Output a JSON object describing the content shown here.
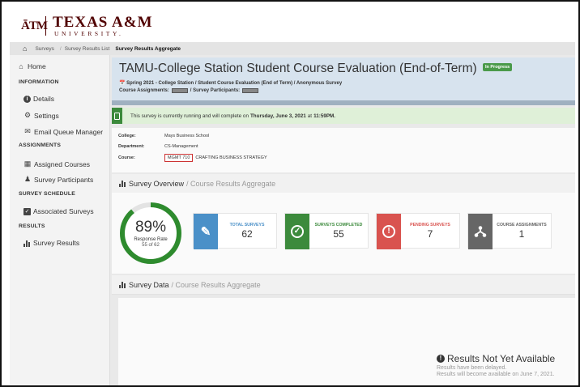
{
  "brand": {
    "logo_mark": "ATM",
    "name": "TEXAS A&M",
    "sub": "UNIVERSITY."
  },
  "breadcrumb": {
    "items": [
      "Surveys",
      "Survey Results List",
      "Survey Results Aggregate"
    ]
  },
  "sidebar": {
    "home": "Home",
    "info_head": "INFORMATION",
    "details": "Details",
    "settings": "Settings",
    "email_queue": "Email Queue Manager",
    "assign_head": "ASSIGNMENTS",
    "assigned_courses": "Assigned Courses",
    "survey_participants": "Survey Participants",
    "schedule_head": "SURVEY SCHEDULE",
    "associated_surveys": "Associated Surveys",
    "results_head": "RESULTS",
    "survey_results": "Survey Results"
  },
  "survey": {
    "title": "TAMU-College Station Student Course Evaluation (End-of-Term)",
    "status": "In Progress",
    "meta": "Spring 2021 - College Station / Student Course Evaluation (End of Term) / Anonymous Survey",
    "course_assignments_label": "Course Assignments:",
    "survey_participants_label": "/ Survey Participants:"
  },
  "alert": {
    "text_before": "This survey is currently running and will complete on",
    "date": "Thursday, June 3, 2021",
    "at": "at",
    "time": "11:59PM."
  },
  "info": {
    "college_label": "College:",
    "college_value": "Mays Business School",
    "department_label": "Department:",
    "department_value": "CS-Management",
    "course_label": "Course:",
    "course_code": "MGMT 710",
    "course_name": "CRAFTING BUSINESS STRATEGY"
  },
  "overview": {
    "title": "Survey Overview",
    "subtitle": "/ Course Results Aggregate",
    "response_rate_pct": "89%",
    "response_rate_fraction": 0.89,
    "response_rate_label": "Response Rate",
    "response_rate_detail": "55 of 62",
    "stats": [
      {
        "label": "TOTAL SURVEYS",
        "value": "62",
        "color": "#4a90c8",
        "label_color": "#4a90c8",
        "icon": "pencil-icon"
      },
      {
        "label": "SURVEYS COMPLETED",
        "value": "55",
        "color": "#3c8a3c",
        "label_color": "#3c8a3c",
        "icon": "check-icon"
      },
      {
        "label": "PENDING SURVEYS",
        "value": "7",
        "color": "#d9534f",
        "label_color": "#d9534f",
        "icon": "exclamation-icon"
      },
      {
        "label": "COURSE ASSIGNMENTS",
        "value": "1",
        "color": "#666666",
        "label_color": "#666666",
        "icon": "sitemap-icon"
      }
    ]
  },
  "survey_data": {
    "title": "Survey Data",
    "subtitle": "/ Course Results Aggregate",
    "nyr_title": "Results Not Yet Available",
    "nyr_line1": "Results have been delayed.",
    "nyr_line2": "Results will become available on June 7, 2021."
  },
  "colors": {
    "brand_maroon": "#500000",
    "gauge_green": "#2e8b2e",
    "header_blue": "#d7e3ee",
    "alert_green": "#dff0d8"
  }
}
